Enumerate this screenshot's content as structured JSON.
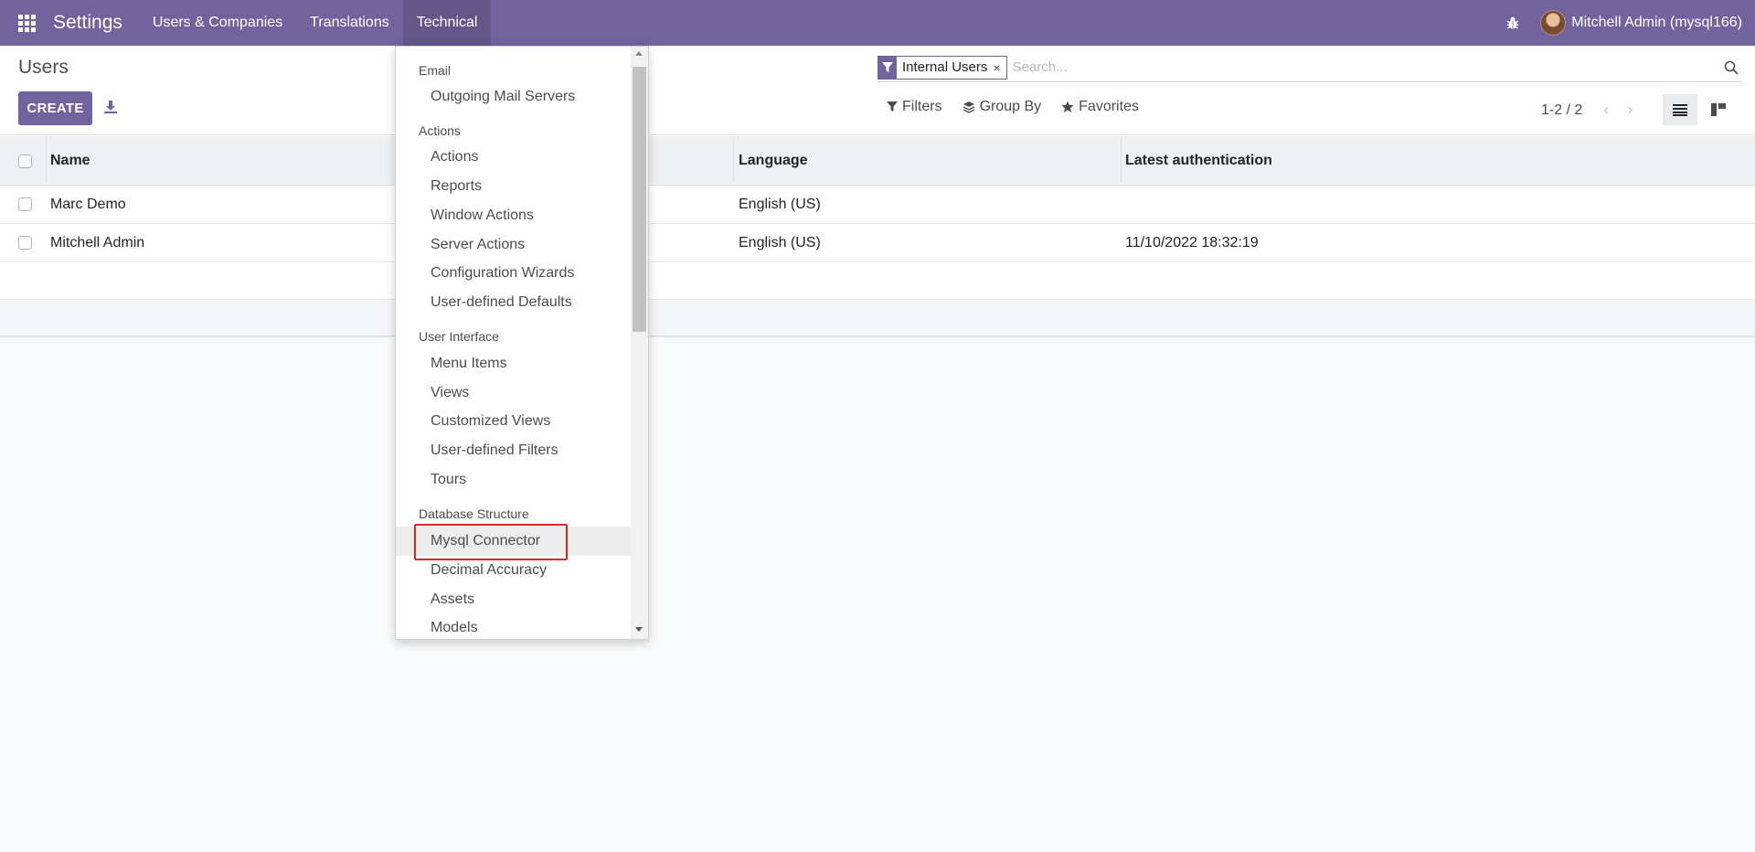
{
  "navbar": {
    "brand": "Settings",
    "menu": [
      "Users & Companies",
      "Translations",
      "Technical"
    ],
    "user": "Mitchell Admin (mysql166)",
    "bg_color": "#71639e"
  },
  "control_panel": {
    "breadcrumb": "Users",
    "create_label": "CREATE",
    "search": {
      "facet": "Internal Users",
      "facet_close": "×",
      "placeholder": "Search..."
    },
    "filters_label": "Filters",
    "groupby_label": "Group By",
    "favorites_label": "Favorites",
    "pager": "1-2 / 2"
  },
  "table": {
    "columns": {
      "name": "Name",
      "language": "Language",
      "latest_auth": "Latest authentication"
    },
    "rows": [
      {
        "name": "Marc Demo",
        "language": "English (US)",
        "latest_auth": ""
      },
      {
        "name": "Mitchell Admin",
        "language": "English (US)",
        "latest_auth": "11/10/2022 18:32:19"
      }
    ]
  },
  "technical_menu": {
    "sections": [
      {
        "header": "Email",
        "items": [
          "Outgoing Mail Servers"
        ]
      },
      {
        "header": "Actions",
        "items": [
          "Actions",
          "Reports",
          "Window Actions",
          "Server Actions",
          "Configuration Wizards",
          "User-defined Defaults"
        ]
      },
      {
        "header": "User Interface",
        "items": [
          "Menu Items",
          "Views",
          "Customized Views",
          "User-defined Filters",
          "Tours"
        ]
      },
      {
        "header": "Database Structure",
        "items": [
          "Mysql Connector",
          "Decimal Accuracy",
          "Assets",
          "Models"
        ]
      }
    ],
    "highlighted_item": "Mysql Connector"
  }
}
